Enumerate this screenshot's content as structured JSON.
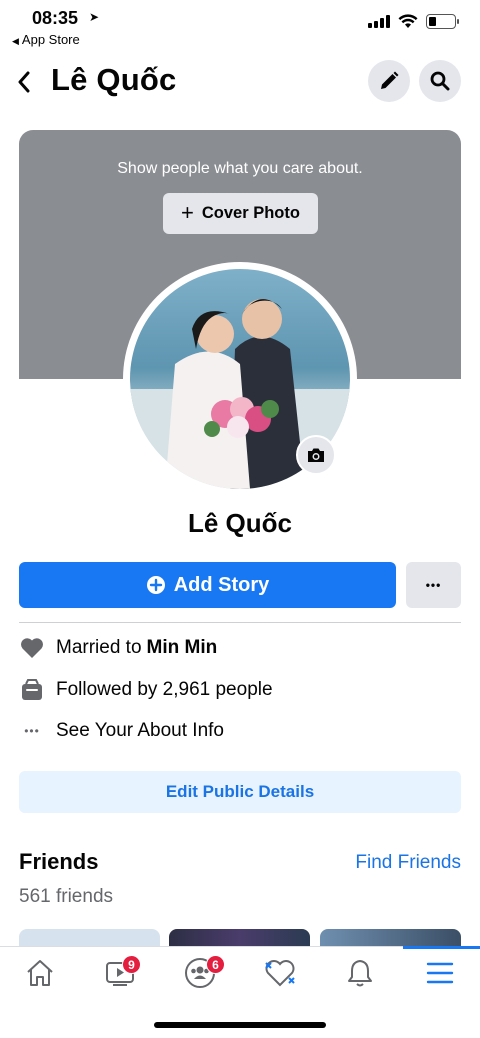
{
  "status_bar": {
    "time": "08:35",
    "back_app": "App Store"
  },
  "header": {
    "title": "Lê Quốc",
    "back_icon": "chevron-left-icon",
    "edit_icon": "pencil-icon",
    "search_icon": "search-icon"
  },
  "cover": {
    "prompt": "Show people what you care about.",
    "button_label": "Cover Photo"
  },
  "profile": {
    "name": "Lê Quốc"
  },
  "actions": {
    "add_story": "Add Story",
    "more": "•••"
  },
  "about": {
    "married_prefix": "Married to",
    "married_name": "Min Min",
    "followed": "Followed by 2,961 people",
    "see_about": "See Your About Info"
  },
  "edit_details": "Edit Public Details",
  "friends": {
    "title": "Friends",
    "find": "Find Friends",
    "count": "561 friends"
  },
  "tabbar": {
    "watch_badge": "9",
    "groups_badge": "6"
  },
  "colors": {
    "accent": "#1877f2",
    "badge": "#e41e3f",
    "cover": "#8a8d91"
  }
}
